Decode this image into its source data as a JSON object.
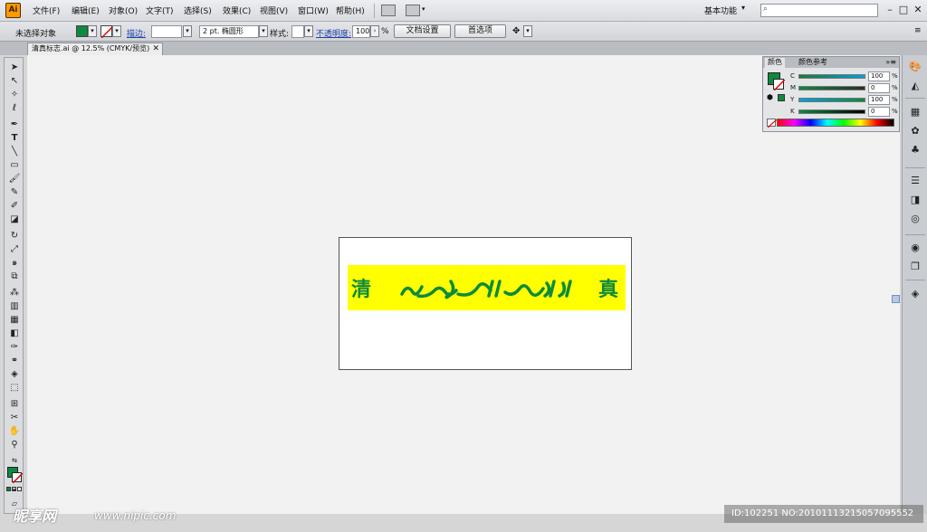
{
  "app": {
    "logo": "Ai"
  },
  "menu": {
    "items": [
      "文件(F)",
      "编辑(E)",
      "对象(O)",
      "文字(T)",
      "选择(S)",
      "效果(C)",
      "视图(V)",
      "窗口(W)",
      "帮助(H)"
    ],
    "workspace": "基本功能"
  },
  "control": {
    "selection": "未选择对象",
    "stroke_link": "描边:",
    "brush": "2 pt. 椭圆形",
    "style": "样式:",
    "opacity_link": "不透明度:",
    "opacity_value": "100",
    "opacity_unit": "%",
    "doc_setup": "文档设置",
    "prefs": "首选项"
  },
  "document": {
    "tab_title": "清真标志.ai @ 12.5% (CMYK/预览)"
  },
  "artwork": {
    "left_char": "清",
    "right_char": "真",
    "fill_color": "#0d8a3e",
    "bg_color": "#ffff00"
  },
  "color_panel": {
    "tab_color": "颜色",
    "tab_guide": "颜色参考",
    "sliders": [
      {
        "label": "C",
        "value": "100"
      },
      {
        "label": "M",
        "value": "0"
      },
      {
        "label": "Y",
        "value": "100"
      },
      {
        "label": "K",
        "value": "0"
      }
    ],
    "unit": "%"
  },
  "watermark": {
    "logo": "昵享网",
    "url": "www.nipic.com",
    "id": "ID:102251 NO:20101113215057095552"
  }
}
